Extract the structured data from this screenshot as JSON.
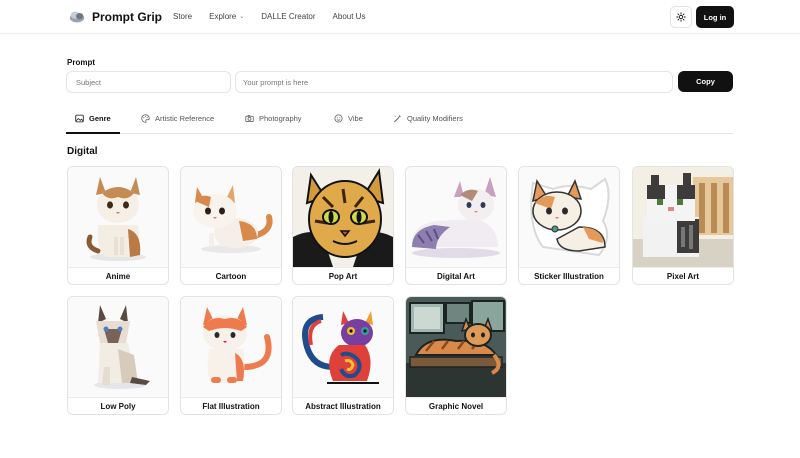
{
  "header": {
    "brand": "Prompt Grip",
    "nav": [
      {
        "label": "Store"
      },
      {
        "label": "Explore",
        "has_chevron": true
      },
      {
        "label": "DALLE Creator"
      },
      {
        "label": "About Us"
      }
    ],
    "login_label": "Log in",
    "theme_icon": "sun-icon"
  },
  "prompt": {
    "label": "Prompt",
    "subject_placeholder": "Subject",
    "prompt_placeholder": "Your prompt is here",
    "copy_label": "Copy"
  },
  "tabs": [
    {
      "label": "Genre",
      "icon": "image-icon",
      "active": true
    },
    {
      "label": "Artistic Reference",
      "icon": "palette-icon",
      "active": false
    },
    {
      "label": "Photography",
      "icon": "camera-icon",
      "active": false
    },
    {
      "label": "Vibe",
      "icon": "smile-icon",
      "active": false
    },
    {
      "label": "Quality Modifiers",
      "icon": "wand-icon",
      "active": false
    }
  ],
  "section": {
    "title": "Digital",
    "cards": [
      {
        "label": "Anime"
      },
      {
        "label": "Cartoon"
      },
      {
        "label": "Pop Art"
      },
      {
        "label": "Digital Art"
      },
      {
        "label": "Sticker Illustration"
      },
      {
        "label": "Pixel Art"
      },
      {
        "label": "Low Poly"
      },
      {
        "label": "Flat Illustration"
      },
      {
        "label": "Abstract Illustration"
      },
      {
        "label": "Graphic Novel"
      }
    ]
  },
  "colors": {
    "primary": "#111111",
    "border": "#e3e3e3",
    "muted_text": "#555555"
  }
}
